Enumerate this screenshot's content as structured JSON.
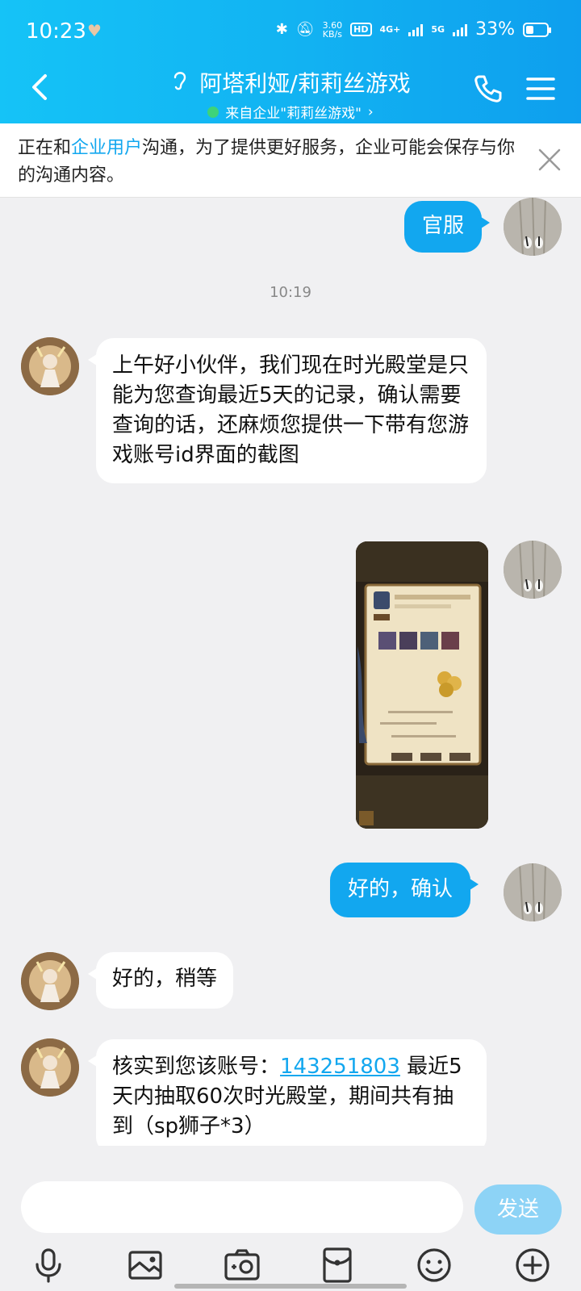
{
  "status_bar": {
    "time": "10:23",
    "network_speed": "3.60\nKB/s",
    "hd_label": "HD",
    "net1": "4G+",
    "net2": "5G",
    "battery": "33%"
  },
  "header": {
    "title": "阿塔利娅/莉莉丝游戏",
    "subtitle": "来自企业\"莉莉丝游戏\"",
    "accent": "#12b3f2"
  },
  "notice": {
    "text_before": "正在和",
    "link": "企业用户",
    "text_after": "沟通，为了提供更好服务，企业可能会保存与你的沟通内容。"
  },
  "messages": {
    "m1": "官服",
    "timestamp": "10:19",
    "m2": "上午好小伙伴，我们现在时光殿堂是只能为您查询最近5天的记录，确认需要查询的话，还麻烦您提供一下带有您游戏账号id界面的截图",
    "m4": "好的，确认",
    "m5": "好的，稍等",
    "m6_before": "核实到您该账号：",
    "m6_uid": "143251803",
    "m6_after": " 最近5天内抽取60次时光殿堂，期间共有抽到（sp狮子*3）"
  },
  "input": {
    "value": "",
    "send_label": "发送"
  },
  "toolbar": [
    "mic-icon",
    "image-icon",
    "camera-icon",
    "red-packet-icon",
    "emoji-icon",
    "plus-icon"
  ]
}
